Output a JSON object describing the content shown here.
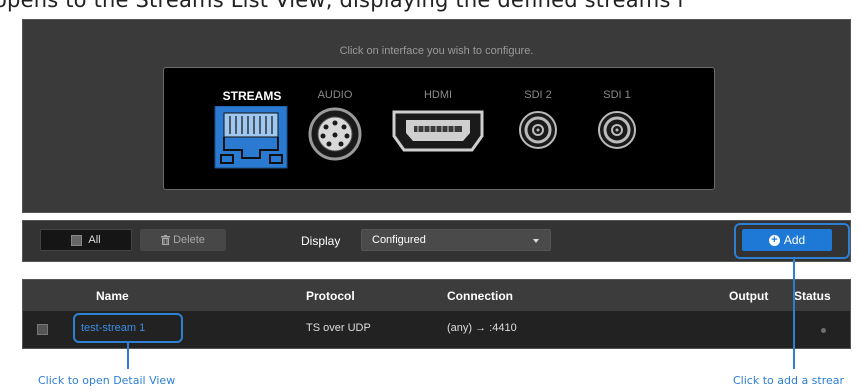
{
  "caption": "opens to the Streams List View, displaying the defined streams r",
  "panel": {
    "hint": "Click on interface you wish to configure.",
    "interfaces": [
      {
        "label": "STREAMS",
        "icon": "ethernet-port-icon"
      },
      {
        "label": "AUDIO",
        "icon": "audio-connector-icon"
      },
      {
        "label": "HDMI",
        "icon": "hdmi-port-icon"
      },
      {
        "label": "SDI 2",
        "icon": "bnc-connector-icon"
      },
      {
        "label": "SDI 1",
        "icon": "bnc-connector-icon"
      }
    ],
    "active_interface": "STREAMS"
  },
  "toolbar": {
    "all_label": "All",
    "delete_label": "Delete",
    "display_label": "Display",
    "display_value": "Configured",
    "add_label": "Add"
  },
  "table": {
    "headers": {
      "name": "Name",
      "protocol": "Protocol",
      "connection": "Connection",
      "output": "Output",
      "status": "Status"
    },
    "rows": [
      {
        "name": "test-stream 1",
        "protocol": "TS over UDP",
        "connection": "(any) → :4410",
        "output": "",
        "status": "inactive"
      }
    ]
  },
  "callouts": {
    "detail": "Click to open Detail View",
    "add": "Click to add a strear"
  },
  "colors": {
    "accent": "#2d7fd3",
    "add_button": "#1d78d6",
    "active_port": "#2a7ad1"
  }
}
